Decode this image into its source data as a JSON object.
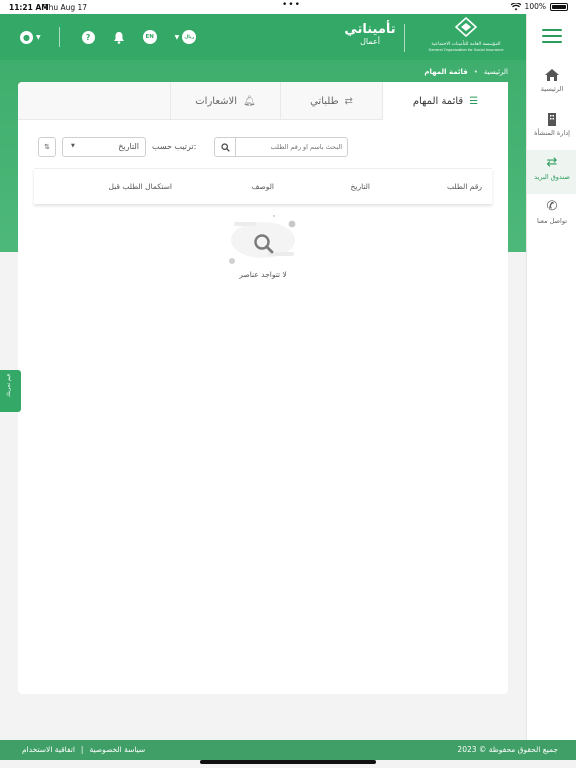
{
  "status_bar": {
    "time": "11:21 AM",
    "date": "Thu Aug 17",
    "battery": "100%"
  },
  "colors": {
    "brand_green": "#33a867",
    "dark_green": "#2d9d5d",
    "footer_green": "#3f9f67"
  },
  "header": {
    "brand_title": "تأميناتي",
    "brand_sub": "أعمال",
    "org_name_ar": "المؤسسة العامة للتأمينات الاجتماعية",
    "org_name_en": "General Organization for Social Insurance",
    "lang_label": "EN",
    "currency_label": "ريال",
    "icons": [
      "user-icon",
      "help-icon",
      "bell-icon",
      "globe-icon",
      "riyal-icon"
    ]
  },
  "breadcrumb": {
    "home": "الرئيسية",
    "current": "قائمة المهام"
  },
  "sidebar": {
    "items": [
      {
        "label": "الرئيسية",
        "icon": "home-icon"
      },
      {
        "label": "إدارة المنشأة",
        "icon": "building-icon"
      },
      {
        "label": "صندوق البريد",
        "icon": "exchange-icon"
      },
      {
        "label": "تواصل معنا",
        "icon": "phone-icon"
      }
    ]
  },
  "tabs": [
    {
      "label": "قائمة المهام",
      "icon": "list-icon",
      "active": true
    },
    {
      "label": "طلباتي",
      "icon": "exchange-icon",
      "active": false
    },
    {
      "label": "الاشعارات",
      "icon": "bell-icon",
      "active": false
    }
  ],
  "filters": {
    "search_placeholder": "البحث باسم او رقم الطلب",
    "sort_label": "ترتيب حسب:",
    "sort_value": "التاريخ"
  },
  "table": {
    "columns": [
      "رقم الطلب",
      "التاريخ",
      "الوصف",
      "استكمال الطلب قبل"
    ],
    "rows": []
  },
  "empty_state": {
    "message": "لا تتواجد عناصر"
  },
  "feedback_tab": "قيم تجربتك",
  "footer": {
    "copyright": "جميع الحقوق محفوظة © 2023",
    "privacy": "سياسة الخصوصية",
    "terms": "اتفاقية الاستخدام",
    "separator": "|"
  }
}
